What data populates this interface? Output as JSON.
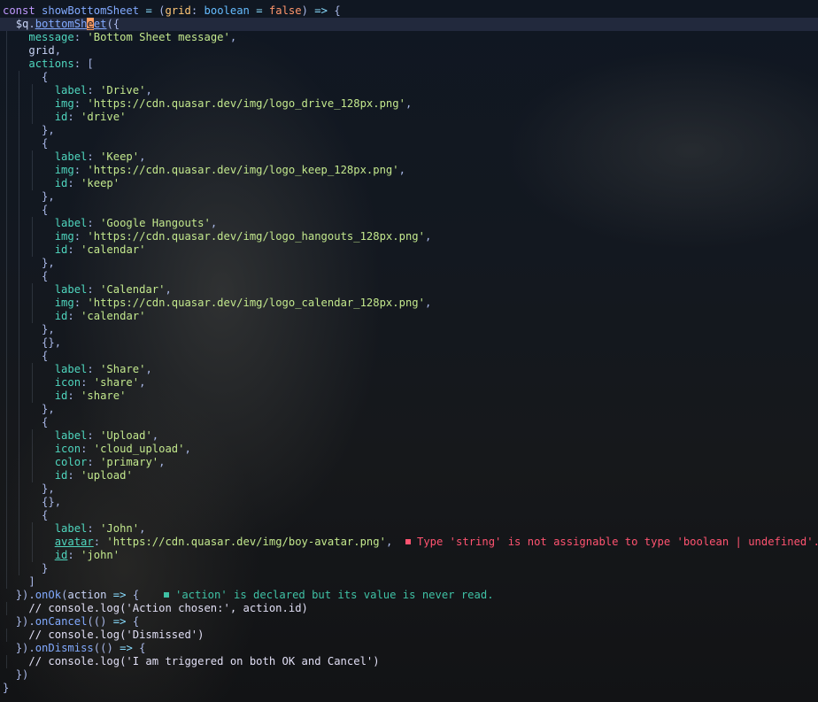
{
  "code": {
    "lines": [
      "const showBottomSheet = (grid: boolean = false) => {",
      "  $q.bottomSheet({",
      "    message: 'Bottom Sheet message',",
      "    grid,",
      "    actions: [",
      "      {",
      "        label: 'Drive',",
      "        img: 'https://cdn.quasar.dev/img/logo_drive_128px.png',",
      "        id: 'drive'",
      "      },",
      "      {",
      "        label: 'Keep',",
      "        img: 'https://cdn.quasar.dev/img/logo_keep_128px.png',",
      "        id: 'keep'",
      "      },",
      "      {",
      "        label: 'Google Hangouts',",
      "        img: 'https://cdn.quasar.dev/img/logo_hangouts_128px.png',",
      "        id: 'calendar'",
      "      },",
      "      {",
      "        label: 'Calendar',",
      "        img: 'https://cdn.quasar.dev/img/logo_calendar_128px.png',",
      "        id: 'calendar'",
      "      },",
      "      {},",
      "      {",
      "        label: 'Share',",
      "        icon: 'share',",
      "        id: 'share'",
      "      },",
      "      {",
      "        label: 'Upload',",
      "        icon: 'cloud_upload',",
      "        color: 'primary',",
      "        id: 'upload'",
      "      },",
      "      {},",
      "      {",
      "        label: 'John',",
      "        avatar: 'https://cdn.quasar.dev/img/boy-avatar.png',",
      "        id: 'john'",
      "      }",
      "    ]",
      "  }).onOk(action => {",
      "    // console.log('Action chosen:', action.id)",
      "  }).onCancel(() => {",
      "    // console.log('Dismissed')",
      "  }).onDismiss(() => {",
      "    // console.log('I am triggered on both OK and Cancel')",
      "  })",
      "}"
    ],
    "current_line_index": 1,
    "cursor_char": "e"
  },
  "diagnostics": {
    "error": "Type 'string' is not assignable to type 'boolean | undefined'.",
    "warning": "'action' is declared but its value is never read."
  },
  "colors": {
    "background": "#0e1218",
    "keyword": "#c099ff",
    "function": "#82aaff",
    "property": "#4fd6be",
    "string": "#c3e88d",
    "parameter": "#ffc777",
    "type": "#65bcff",
    "boolean": "#ff966c",
    "error": "#ff5370",
    "warning": "#3fc1a5",
    "cursor": "#ff9e64"
  },
  "icons": {
    "error": "error-square-icon",
    "warning": "warning-square-icon"
  }
}
